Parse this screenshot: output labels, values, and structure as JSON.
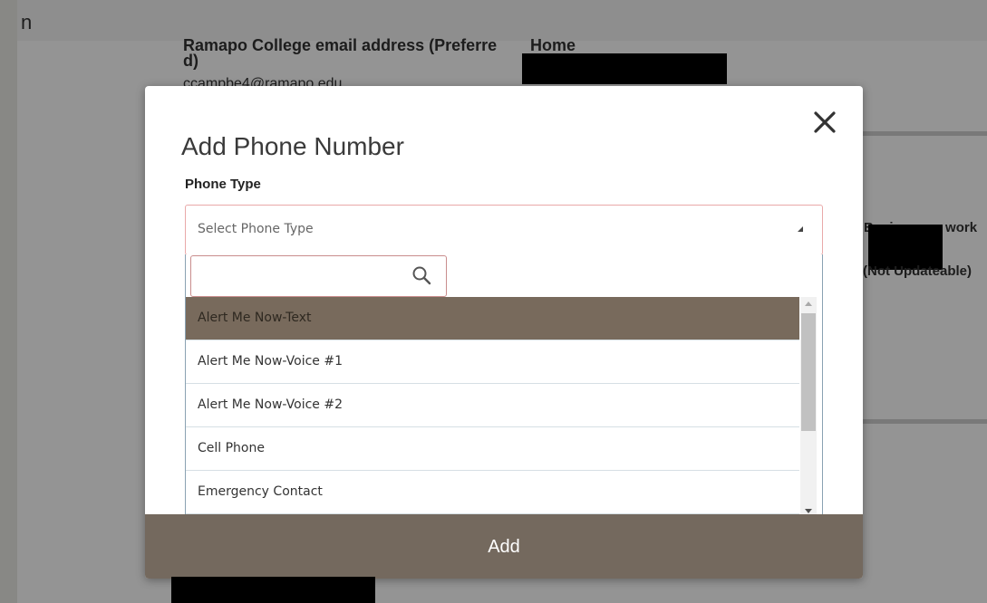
{
  "background": {
    "topbar_title": "n",
    "email_label": "Ramapo College email address (Preferre d)",
    "email_value": "ccampbe4@ramapo.edu",
    "home_label": "Home",
    "business_label_1": "Business or work",
    "business_label_2": "(Not Updateable)"
  },
  "modal": {
    "title": "Add Phone Number",
    "close_icon": "close-icon",
    "field_label": "Phone Type",
    "select_placeholder": "Select Phone Type",
    "search": {
      "value": "",
      "placeholder": ""
    },
    "options": [
      "Alert Me Now-Text",
      "Alert Me Now-Voice #1",
      "Alert Me Now-Voice #2",
      "Cell Phone",
      "Emergency Contact"
    ],
    "selected_option": "Alert Me Now-Text",
    "add_label": "Add"
  },
  "colors": {
    "accent": "#74695e",
    "selected_option": "#786a5c",
    "select_border": "#e9a9a9"
  }
}
